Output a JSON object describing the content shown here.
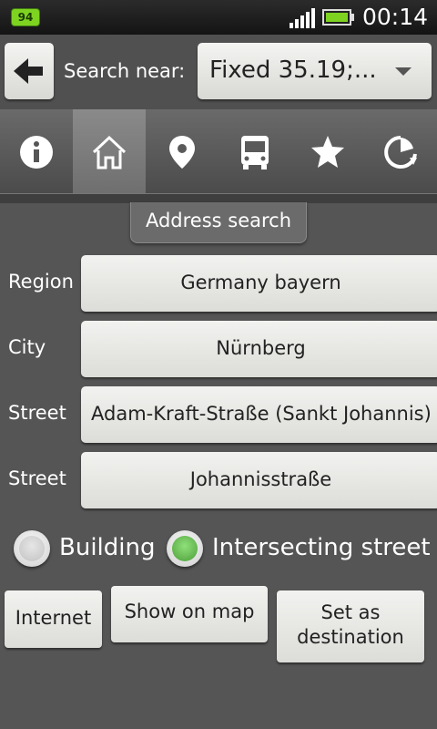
{
  "status_bar": {
    "badge": "94",
    "time": "00:14",
    "icons": [
      "signal-icon",
      "battery-icon"
    ],
    "battery_color": "#7ed321"
  },
  "header": {
    "back_icon": "arrow-left-icon",
    "search_label": "Search near:",
    "location_value": "Fixed 35.19;..."
  },
  "tabs": [
    {
      "icon": "info-icon",
      "selected": false
    },
    {
      "icon": "home-icon",
      "selected": true
    },
    {
      "icon": "location-pin-icon",
      "selected": false
    },
    {
      "icon": "bus-icon",
      "selected": false
    },
    {
      "icon": "star-icon",
      "selected": false
    },
    {
      "icon": "history-icon",
      "selected": false
    }
  ],
  "section_title": "Address search",
  "form": {
    "region_label": "Region",
    "region_value": "Germany bayern",
    "city_label": "City",
    "city_value": "Nürnberg",
    "street1_label": "Street",
    "street1_value": "Adam-Kraft-Straße (Sankt Johannis)",
    "street2_label": "Street",
    "street2_value": "Johannisstraße"
  },
  "radios": {
    "building_label": "Building",
    "building_checked": false,
    "intersecting_label": "Intersecting street",
    "intersecting_checked": true
  },
  "actions": {
    "internet": "Internet",
    "show_on_map": "Show on map",
    "set_destination_line1": "Set as",
    "set_destination_line2": "destination"
  },
  "colors": {
    "background": "#555555",
    "button": "#e8e8e6",
    "radio_checked": "#6cc256"
  }
}
